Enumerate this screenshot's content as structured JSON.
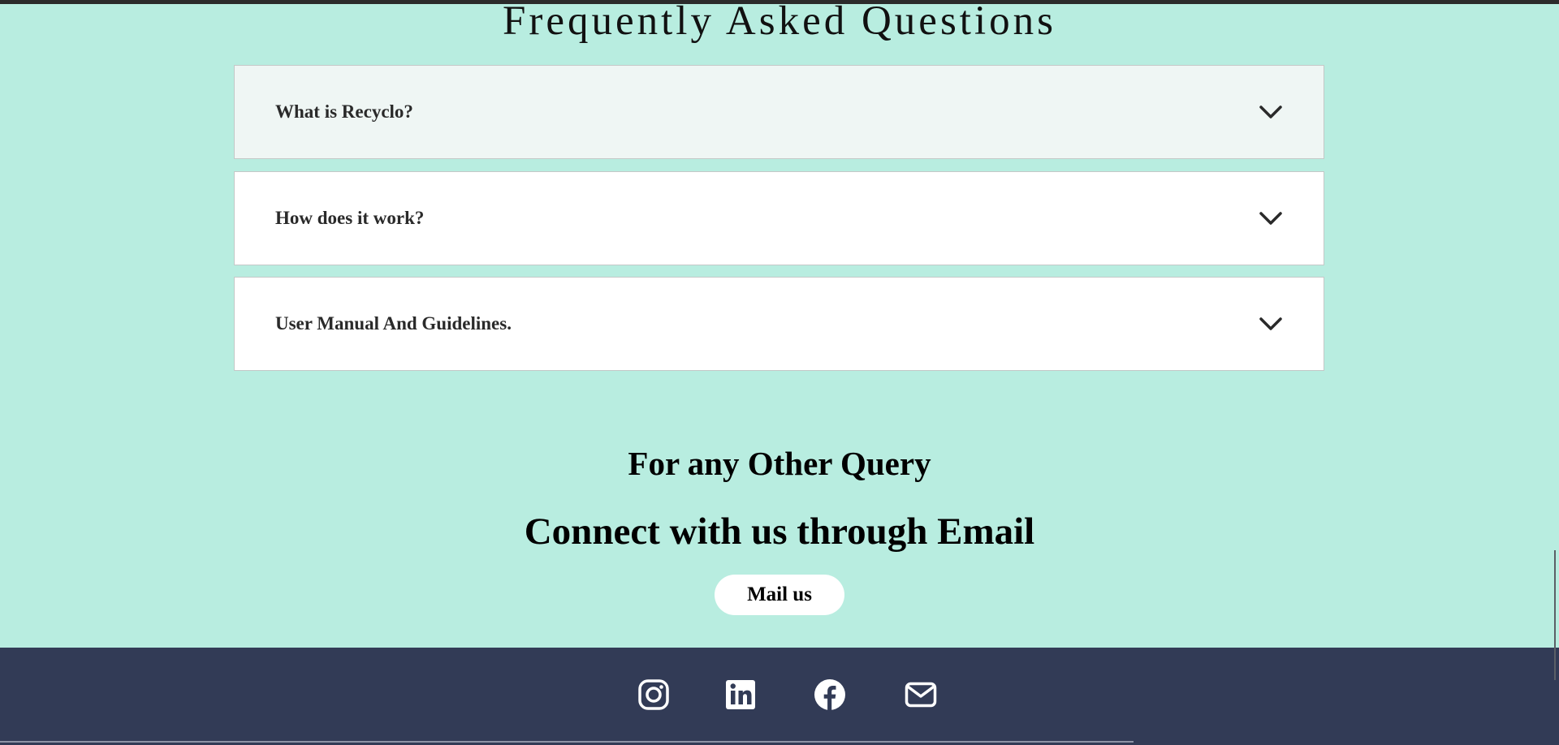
{
  "faq": {
    "title": "Frequently Asked Questions",
    "items": [
      {
        "question": "What is Recyclo?"
      },
      {
        "question": "How does it work?"
      },
      {
        "question": "User Manual And Guidelines."
      }
    ]
  },
  "contact": {
    "query_heading": "For any Other Query",
    "email_heading": "Connect with us through Email",
    "mail_button": "Mail us"
  },
  "footer": {
    "social_icons": [
      "instagram-icon",
      "linkedin-icon",
      "facebook-icon",
      "mail-icon"
    ]
  },
  "colors": {
    "page_background": "#b8ede0",
    "footer_background": "#323b56",
    "active_item_background": "#eff6f4"
  }
}
